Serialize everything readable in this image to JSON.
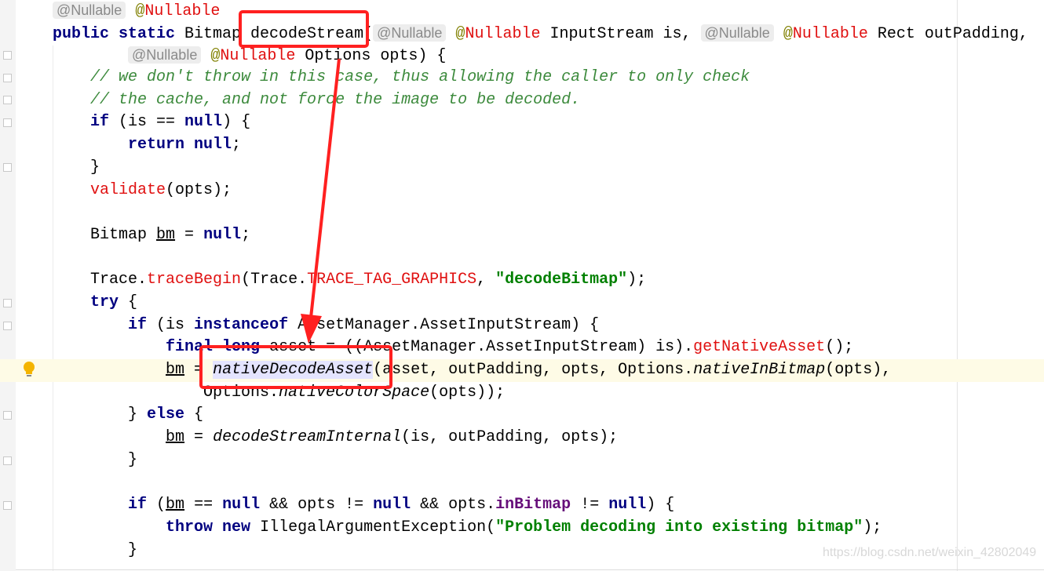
{
  "editor": {
    "current_line": 16,
    "lines": [
      [
        [
          "inlay",
          "@Nullable"
        ],
        [
          "sp",
          " "
        ],
        [
          "at",
          "@"
        ],
        [
          "annn",
          "Nullable"
        ]
      ],
      [
        [
          "kw",
          "public static "
        ],
        [
          "p",
          "Bitmap "
        ],
        [
          "p",
          "decodeStream"
        ],
        [
          "p",
          "("
        ],
        [
          "inlay",
          "@Nullable"
        ],
        [
          "sp",
          " "
        ],
        [
          "at",
          "@"
        ],
        [
          "annn",
          "Nullable"
        ],
        [
          "p",
          " InputStream is, "
        ],
        [
          "inlay",
          "@Nullable"
        ],
        [
          "sp",
          " "
        ],
        [
          "at",
          "@"
        ],
        [
          "annn",
          "Nullable"
        ],
        [
          "p",
          " Rect outPadding,"
        ]
      ],
      [
        [
          "p",
          "        "
        ],
        [
          "inlay",
          "@Nullable"
        ],
        [
          "sp",
          " "
        ],
        [
          "at",
          "@"
        ],
        [
          "annn",
          "Nullable"
        ],
        [
          "p",
          " Options opts) {"
        ]
      ],
      [
        [
          "p",
          "    "
        ],
        [
          "cmt",
          "// we don't throw in this case, thus allowing the caller to only check"
        ]
      ],
      [
        [
          "p",
          "    "
        ],
        [
          "cmt",
          "// the cache, and not force the image to be decoded."
        ]
      ],
      [
        [
          "p",
          "    "
        ],
        [
          "kw",
          "if"
        ],
        [
          "p",
          " (is == "
        ],
        [
          "kw",
          "null"
        ],
        [
          "p",
          ") {"
        ]
      ],
      [
        [
          "p",
          "        "
        ],
        [
          "kw",
          "return null"
        ],
        [
          "p",
          ";"
        ]
      ],
      [
        [
          "p",
          "    }"
        ]
      ],
      [
        [
          "p",
          "    "
        ],
        [
          "call",
          "validate"
        ],
        [
          "p",
          "(opts);"
        ]
      ],
      [],
      [
        [
          "p",
          "    Bitmap "
        ],
        [
          "ul",
          "bm"
        ],
        [
          "p",
          " = "
        ],
        [
          "kw",
          "null"
        ],
        [
          "p",
          ";"
        ]
      ],
      [],
      [
        [
          "p",
          "    Trace."
        ],
        [
          "call",
          "traceBegin"
        ],
        [
          "p",
          "(Trace."
        ],
        [
          "fieldr",
          "TRACE_TAG_GRAPHICS"
        ],
        [
          "p",
          ", "
        ],
        [
          "str",
          "\"decodeBitmap\""
        ],
        [
          "p",
          ");"
        ]
      ],
      [
        [
          "p",
          "    "
        ],
        [
          "kw",
          "try"
        ],
        [
          "p",
          " {"
        ]
      ],
      [
        [
          "p",
          "        "
        ],
        [
          "kw",
          "if"
        ],
        [
          "p",
          " (is "
        ],
        [
          "kw",
          "instanceof"
        ],
        [
          "p",
          " AssetManager.AssetInputStream) {"
        ]
      ],
      [
        [
          "p",
          "            "
        ],
        [
          "kw",
          "final long"
        ],
        [
          "p",
          " asset = ((AssetManager.AssetInputStream) is)."
        ],
        [
          "call",
          "getNativeAsset"
        ],
        [
          "p",
          "();"
        ]
      ],
      [
        [
          "p",
          "            "
        ],
        [
          "ul",
          "bm"
        ],
        [
          "p",
          " = "
        ],
        [
          "hl",
          "nativeDecodeAsset"
        ],
        [
          "p",
          "(asset, outPadding, opts, Options."
        ],
        [
          "it",
          "nativeInBitmap"
        ],
        [
          "p",
          "(opts),"
        ]
      ],
      [
        [
          "p",
          "                Options."
        ],
        [
          "it",
          "nativeColorSpace"
        ],
        [
          "p",
          "(opts));"
        ]
      ],
      [
        [
          "p",
          "        } "
        ],
        [
          "kw",
          "else"
        ],
        [
          "p",
          " {"
        ]
      ],
      [
        [
          "p",
          "            "
        ],
        [
          "ul",
          "bm"
        ],
        [
          "p",
          " = "
        ],
        [
          "it",
          "decodeStreamInternal"
        ],
        [
          "p",
          "(is, outPadding, opts);"
        ]
      ],
      [
        [
          "p",
          "        }"
        ]
      ],
      [],
      [
        [
          "p",
          "        "
        ],
        [
          "kw",
          "if"
        ],
        [
          "p",
          " ("
        ],
        [
          "ul",
          "bm"
        ],
        [
          "p",
          " == "
        ],
        [
          "kw",
          "null"
        ],
        [
          "p",
          " && opts != "
        ],
        [
          "kw",
          "null"
        ],
        [
          "p",
          " && opts."
        ],
        [
          "field",
          "inBitmap"
        ],
        [
          "p",
          " != "
        ],
        [
          "kw",
          "null"
        ],
        [
          "p",
          ") {"
        ]
      ],
      [
        [
          "p",
          "            "
        ],
        [
          "kw",
          "throw new"
        ],
        [
          "p",
          " IllegalArgumentException("
        ],
        [
          "str",
          "\"Problem decoding into existing bitmap\""
        ],
        [
          "p",
          ");"
        ]
      ],
      [
        [
          "p",
          "        }"
        ]
      ]
    ]
  },
  "annotations": {
    "box_color": "#ff2020",
    "arrow_color": "#ff2020"
  },
  "watermark": "https://blog.csdn.net/weixin_42802049",
  "icons": {
    "intention": "lightbulb-icon"
  }
}
